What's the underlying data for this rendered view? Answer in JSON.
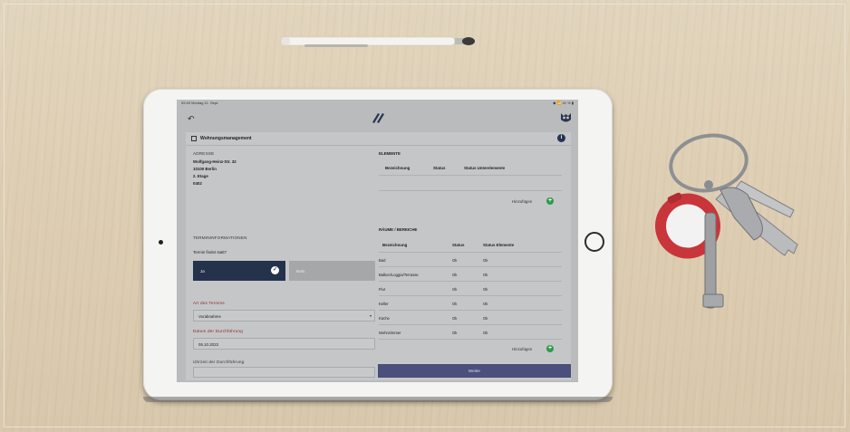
{
  "status_bar": {
    "left": "09:40 Montag 11. Sept.",
    "right": "◆ 📶 41 % ▮"
  },
  "app": {
    "back_icon": "undo-arrow-icon",
    "logo_icon": "brand-logo-icon",
    "user_icon": "owl-avatar-icon"
  },
  "card": {
    "title": "Wohnungsmanagement",
    "info_icon": "info-icon",
    "address": {
      "label": "ADRESSE",
      "street": "Wolfgang-Heinz-Str. 32",
      "city": "10100 Berlin",
      "floor": "2. Etage",
      "unit": "0402"
    },
    "appointment": {
      "section_label": "TERMININFORMATIONEN",
      "question": "Termin findet statt?",
      "yes_label": "Ja",
      "no_label": "Nein",
      "type_label": "Art des Termins",
      "type_value": "Vorabnahme",
      "date_label": "Datum der Durchführung",
      "date_value": "05.10.2023",
      "time_label": "Uhrzeit der Durchführung",
      "time_value": ""
    },
    "elements": {
      "title": "ELEMENTE",
      "columns": [
        "Bezeichnung",
        "Status",
        "Status Unterelemente"
      ],
      "add_label": "Hinzufügen"
    },
    "rooms": {
      "title": "RÄUME / BEREICHE",
      "columns": [
        "Bezeichnung",
        "Status",
        "Status Elemente"
      ],
      "rows": [
        {
          "name": "Bad",
          "status": "Ok",
          "elements": "Ok"
        },
        {
          "name": "Balkon/Loggia/Terrasse",
          "status": "Ok",
          "elements": "Ok"
        },
        {
          "name": "Flur",
          "status": "Ok",
          "elements": "Ok"
        },
        {
          "name": "Keller",
          "status": "Ok",
          "elements": "Ok"
        },
        {
          "name": "Küche",
          "status": "Ok",
          "elements": "Ok"
        },
        {
          "name": "Wohnzimmer",
          "status": "Ok",
          "elements": "Ok"
        }
      ],
      "add_label": "Hinzufügen"
    },
    "continue_label": "Weiter"
  },
  "colors": {
    "primary": "#24324c",
    "accent_green": "#2f9a4a",
    "label_red": "#8a2a2a",
    "continue_bg": "#4a4f7c"
  }
}
